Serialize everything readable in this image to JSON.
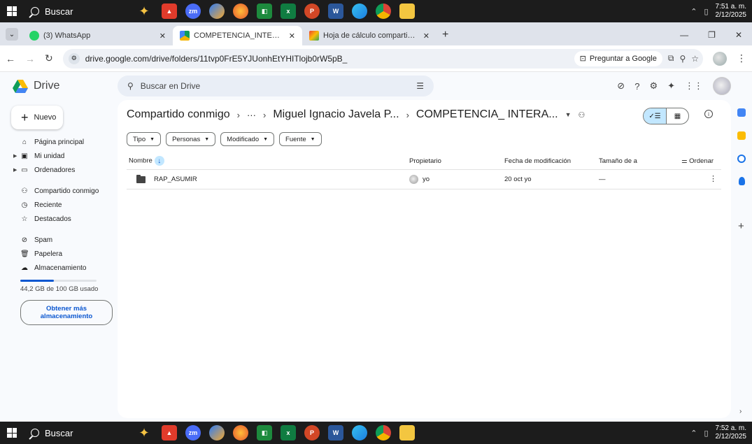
{
  "taskbar": {
    "search_label": "Buscar",
    "top_clock": {
      "time": "7:51 a. m.",
      "date": "2/12/2025"
    },
    "bottom_clock": {
      "time": "7:52 a. m.",
      "date": "2/12/2025"
    },
    "apps": [
      "zm",
      "x",
      "P",
      "W"
    ]
  },
  "browser": {
    "tabs": [
      {
        "title": "(3) WhatsApp"
      },
      {
        "title": "COMPETENCIA_INTERACCION"
      },
      {
        "title": "Hoja de cálculo compartida con"
      }
    ],
    "url": "drive.google.com/drive/folders/11tvp0FrE5YJUonhEtYHITlojb0rW5pB_",
    "ask_google": "Preguntar a Google"
  },
  "drive": {
    "app_name": "Drive",
    "search_placeholder": "Buscar en Drive",
    "new_label": "Nuevo",
    "nav": {
      "home": "Página principal",
      "my_drive": "Mi unidad",
      "computers": "Ordenadores",
      "shared": "Compartido conmigo",
      "recent": "Reciente",
      "starred": "Destacados",
      "spam": "Spam",
      "trash": "Papelera",
      "storage": "Almacenamiento"
    },
    "storage_used_text": "44,2 GB de 100 GB usado",
    "storage_fraction": 0.442,
    "get_more_line1": "Obtener más",
    "get_more_line2": "almacenamiento",
    "breadcrumb": {
      "root": "Compartido conmigo",
      "ellipsis": "···",
      "owner": "Miguel Ignacio Javela P...",
      "current": "COMPETENCIA_ INTERA..."
    },
    "filters": [
      "Tipo",
      "Personas",
      "Modificado",
      "Fuente"
    ],
    "columns": {
      "name": "Nombre",
      "owner": "Propietario",
      "modified": "Fecha de modificación",
      "size": "Tamaño de a",
      "sort": "Ordenar"
    },
    "rows": [
      {
        "name": "RAP_ASUMIR",
        "owner": "yo",
        "modified": "20 oct yo",
        "size": "—"
      }
    ]
  },
  "colors": {
    "accent": "#0b57d0",
    "chip_selected": "#c2e7ff",
    "page_bg": "#f8fafd",
    "taskbar": "#1c1c1c"
  }
}
